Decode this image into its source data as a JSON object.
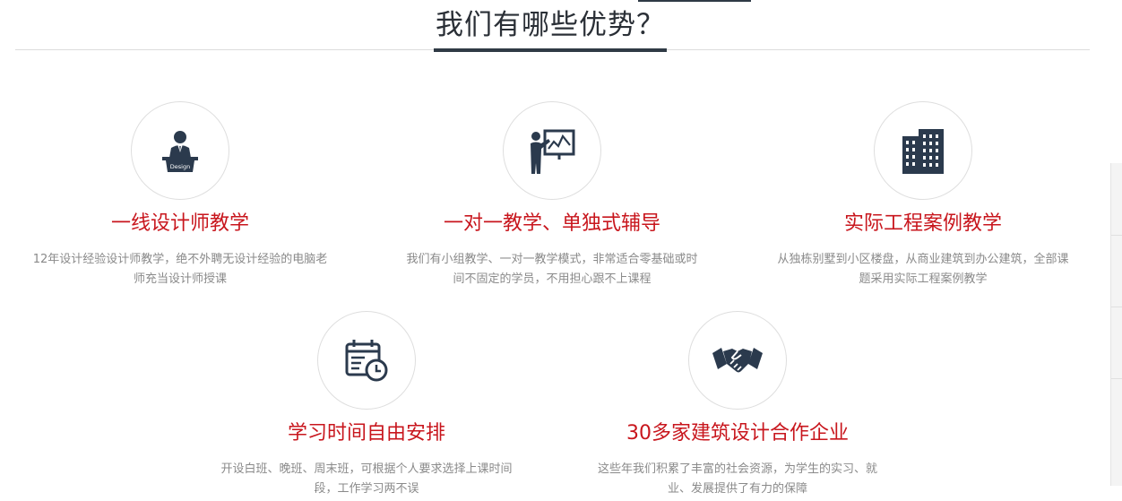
{
  "section": {
    "title": "我们有哪些优势？"
  },
  "features": [
    {
      "icon": "teacher-podium-icon",
      "icon_text": "Design",
      "title": "一线设计师教学",
      "desc": "12年设计经验设计师教学，绝不外聘无设计经验的电脑老师充当设计师授课"
    },
    {
      "icon": "presentation-board-icon",
      "title": "一对一教学、单独式辅导",
      "desc": "我们有小组教学、一对一教学模式，非常适合零基础或时间不固定的学员，不用担心跟不上课程"
    },
    {
      "icon": "buildings-icon",
      "title": "实际工程案例教学",
      "desc": "从独栋别墅到小区楼盘，从商业建筑到办公建筑，全部课题采用实际工程案例教学"
    },
    {
      "icon": "calendar-clock-icon",
      "title": "学习时间自由安排",
      "desc": "开设白班、晚班、周末班，可根据个人要求选择上课时间段，工作学习两不误"
    },
    {
      "icon": "handshake-icon",
      "title": "30多家建筑设计合作企业",
      "desc": "这些年我们积累了丰富的社会资源，为学生的实习、就业、发展提供了有力的保障"
    }
  ]
}
